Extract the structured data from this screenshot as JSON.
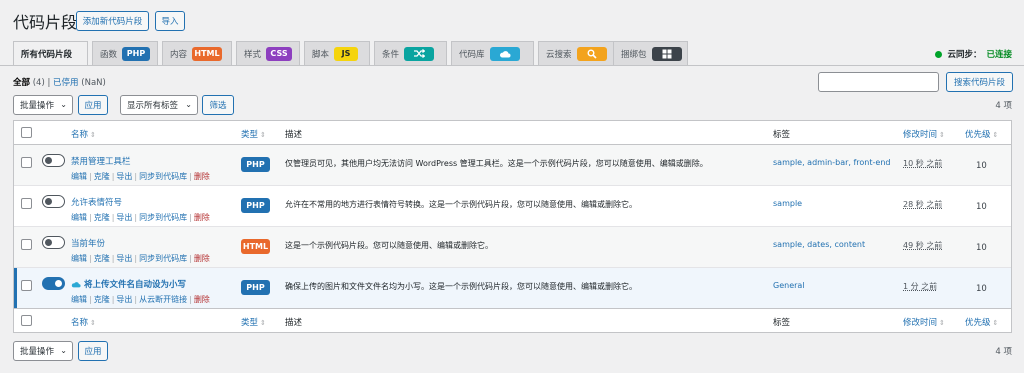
{
  "page": {
    "title": "代码片段",
    "add_new_label": "添加新代码片段",
    "import_label": "导入"
  },
  "tabs": [
    {
      "label": "所有代码片段",
      "active": true
    },
    {
      "label": "函数",
      "badge": "PHP",
      "badge_color": "#2271b1"
    },
    {
      "label": "内容",
      "badge": "HTML",
      "badge_color": "#e9692c"
    },
    {
      "label": "样式",
      "badge": "CSS",
      "badge_color": "#8d3fbf"
    },
    {
      "label": "脚本",
      "badge": "JS",
      "badge_color": "#f5d40d",
      "badge_text_color": "#1d2327"
    },
    {
      "label": "条件",
      "badge_icon": "shuffle-icon",
      "badge_color": "#0aa4a0"
    },
    {
      "label": "代码库",
      "badge_icon": "cloud-icon",
      "badge_color": "#2aa8d4"
    },
    {
      "label": "云搜索",
      "badge_icon": "search-icon",
      "badge_color": "#f3a31d"
    },
    {
      "label": "捆绑包",
      "badge_icon": "grid-icon",
      "badge_color": "#3c434a"
    }
  ],
  "sync": {
    "label": "云同步：",
    "status": "已连接",
    "dot_color": "#00a32a"
  },
  "filters": {
    "all_label": "全部",
    "all_count": "(4)",
    "separator": "|",
    "inactive_label": "已停用",
    "inactive_count": "(NaN)"
  },
  "search": {
    "placeholder": "",
    "button_label": "搜索代码片段"
  },
  "toolbar": {
    "bulk_label": "批量操作",
    "apply_label": "应用",
    "tag_filter_label": "显示所有标签",
    "filter_label": "筛选",
    "items_count": "4 项"
  },
  "columns": {
    "name": "名称",
    "type": "类型",
    "description": "描述",
    "tags": "标签",
    "modified": "修改时间",
    "priority": "优先级"
  },
  "rows": [
    {
      "name": "禁用管理工具栏",
      "active": false,
      "actions": [
        "编辑",
        "克隆",
        "导出",
        "同步到代码库",
        "删除"
      ],
      "type": "PHP",
      "type_color": "#2271b1",
      "description": "仅管理员可见，其他用户均无法访问 WordPress 管理工具栏。这是一个示例代码片段，您可以随意使用、编辑或删除。",
      "tags": "sample, admin-bar, front-end",
      "modified": "10 秒 之前",
      "priority": "10"
    },
    {
      "name": "允许表情符号",
      "active": false,
      "actions": [
        "编辑",
        "克隆",
        "导出",
        "同步到代码库",
        "删除"
      ],
      "type": "PHP",
      "type_color": "#2271b1",
      "description": "允许在不常用的地方进行表情符号转换。这是一个示例代码片段，您可以随意使用、编辑或删除它。",
      "tags": "sample",
      "modified": "28 秒 之前",
      "priority": "10"
    },
    {
      "name": "当前年份",
      "active": false,
      "actions": [
        "编辑",
        "克隆",
        "导出",
        "同步到代码库",
        "删除"
      ],
      "type": "HTML",
      "type_color": "#e9692c",
      "description": "这是一个示例代码片段。您可以随意使用、编辑或删除它。",
      "tags": "sample, dates, content",
      "modified": "49 秒 之前",
      "priority": "10"
    },
    {
      "name": "将上传文件名自动设为小写",
      "active": true,
      "cloud": true,
      "actions": [
        "编辑",
        "克隆",
        "导出",
        "从云断开链接",
        "删除"
      ],
      "type": "PHP",
      "type_color": "#2271b1",
      "description": "确保上传的图片和文件文件名均为小写。这是一个示例代码片段，您可以随意使用、编辑或删除它。",
      "tags": "General",
      "modified": "1 分 之前",
      "priority": "10"
    }
  ]
}
